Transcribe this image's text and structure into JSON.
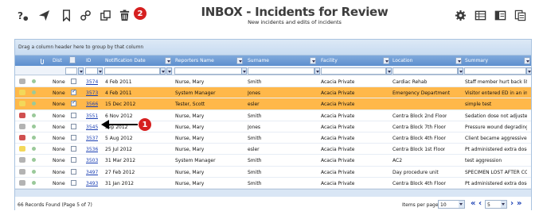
{
  "toolbar": {
    "title": "INBOX - Incidents for Review",
    "subtitle": "New incidents and edits of incidents",
    "badge": "2",
    "icons_left": [
      "help-icon",
      "send-icon",
      "bookmark-icon",
      "link-icon",
      "copy-icon",
      "trash-icon"
    ],
    "icons_right": [
      "gear-icon",
      "grid-icon",
      "columns-icon",
      "export-icon"
    ]
  },
  "grid": {
    "group_hint": "Drag a column header here to group by that column",
    "columns": {
      "dist": "Dist",
      "id": "ID",
      "notification_date": "Notification Date",
      "reporters_name": "Reporters Name",
      "surname": "Surname",
      "facility": "Facility",
      "location": "Location",
      "summary": "Summary"
    },
    "rows": [
      {
        "dist": "None",
        "checked": false,
        "id": "3574",
        "date": "4 Feb 2011",
        "reporter": "Nurse, Mary",
        "surname": "Smith",
        "facility": "Acacia Private",
        "location": "Cardiac Rehab",
        "summary": "Staff member hurt back lifti...",
        "selected": false,
        "icon": "grey"
      },
      {
        "dist": "None",
        "checked": true,
        "id": "3573",
        "date": "4 Feb 2011",
        "reporter": "System Manager",
        "surname": "Jones",
        "facility": "Acacia Private",
        "location": "Emergency Department",
        "summary": "Visitor entered ED in an int...",
        "selected": true,
        "icon": "yellow"
      },
      {
        "dist": "None",
        "checked": true,
        "id": "3566",
        "date": "15 Dec 2012",
        "reporter": "Tester, Scott",
        "surname": "esler",
        "facility": "Acacia Private",
        "location": "",
        "summary": "simple test",
        "selected": true,
        "icon": "yellow"
      },
      {
        "dist": "None",
        "checked": false,
        "id": "3551",
        "date": "6 Nov 2012",
        "reporter": "Nurse, Mary",
        "surname": "Smith",
        "facility": "Acacia Private",
        "location": "Centra Block 2nd Floor",
        "summary": "Sedation dose not adjusted...",
        "selected": false,
        "icon": "red"
      },
      {
        "dist": "None",
        "checked": false,
        "id": "3545",
        "date": "Sep 2012",
        "reporter": "Nurse, Mary",
        "surname": "Jones",
        "facility": "Acacia Private",
        "location": "Centra Block 7th Floor",
        "summary": "Pressure wound degrading ...",
        "selected": false,
        "icon": "grey"
      },
      {
        "dist": "None",
        "checked": false,
        "id": "3537",
        "date": "5 Aug 2012",
        "reporter": "Nurse, Mary",
        "surname": "Smith",
        "facility": "Acacia Private",
        "location": "Centra Block 4th Floor",
        "summary": "Client became aggressive d...",
        "selected": false,
        "icon": "red"
      },
      {
        "dist": "None",
        "checked": false,
        "id": "3536",
        "date": "25 Jul 2012",
        "reporter": "Nurse, Mary",
        "surname": "esler",
        "facility": "Acacia Private",
        "location": "Centra Block 1st Floor",
        "summary": "Pt administered extra dose ...",
        "selected": false,
        "icon": "yellow"
      },
      {
        "dist": "None",
        "checked": false,
        "id": "3503",
        "date": "31 Mar 2012",
        "reporter": "System Manager",
        "surname": "Smith",
        "facility": "Acacia Private",
        "location": "AC2",
        "summary": "test aggression",
        "selected": false,
        "icon": "grey"
      },
      {
        "dist": "None",
        "checked": false,
        "id": "3497",
        "date": "27 Feb 2012",
        "reporter": "Nurse, Mary",
        "surname": "Smith",
        "facility": "Acacia Private",
        "location": "Day procedure unit",
        "summary": "SPECIMEN LOST AFTER CO...",
        "selected": false,
        "icon": "grey"
      },
      {
        "dist": "None",
        "checked": false,
        "id": "3493",
        "date": "31 Jan 2012",
        "reporter": "Nurse, Mary",
        "surname": "Smith",
        "facility": "Acacia Private",
        "location": "Centra Block 4th Floor",
        "summary": "Pt administered extra dose ...",
        "selected": false,
        "icon": "grey"
      }
    ]
  },
  "footer": {
    "status": "66 Records Found (Page 5 of 7)",
    "items_per_page_label": "Items per page:",
    "items_per_page_value": "10",
    "page_value": "5"
  },
  "callout": {
    "badge": "1"
  },
  "colors": {
    "selected_row": "#ffb84a",
    "header": "#5d8fcf",
    "badge": "#d62020",
    "link": "#1a3fb3"
  }
}
